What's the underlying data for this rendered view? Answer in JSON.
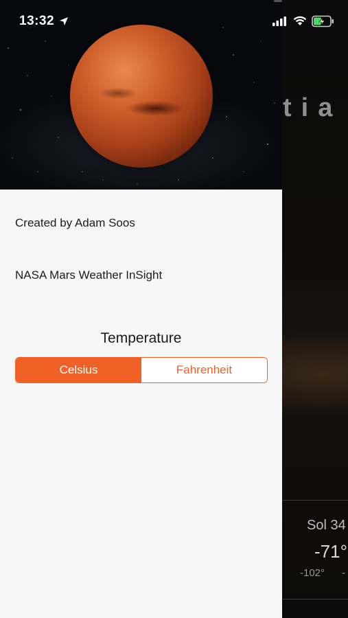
{
  "status_bar": {
    "time": "13:32"
  },
  "background": {
    "title_fragment": "tia",
    "sol_label": "Sol 34",
    "temp_avg": "-71°",
    "temp_low": "-102°",
    "temp_low2": "-"
  },
  "menu": {
    "credit": "Created by Adam Soos",
    "app_name": "NASA Mars Weather InSight",
    "temperature_heading": "Temperature",
    "units": {
      "celsius": "Celsius",
      "fahrenheit": "Fahrenheit",
      "selected": "Celsius"
    }
  },
  "colors": {
    "accent": "#f06127",
    "drawer_bg": "#f7f7f7"
  },
  "icons": [
    "location-arrow-icon",
    "cellular-signal-icon",
    "wifi-icon",
    "battery-charging-icon"
  ]
}
